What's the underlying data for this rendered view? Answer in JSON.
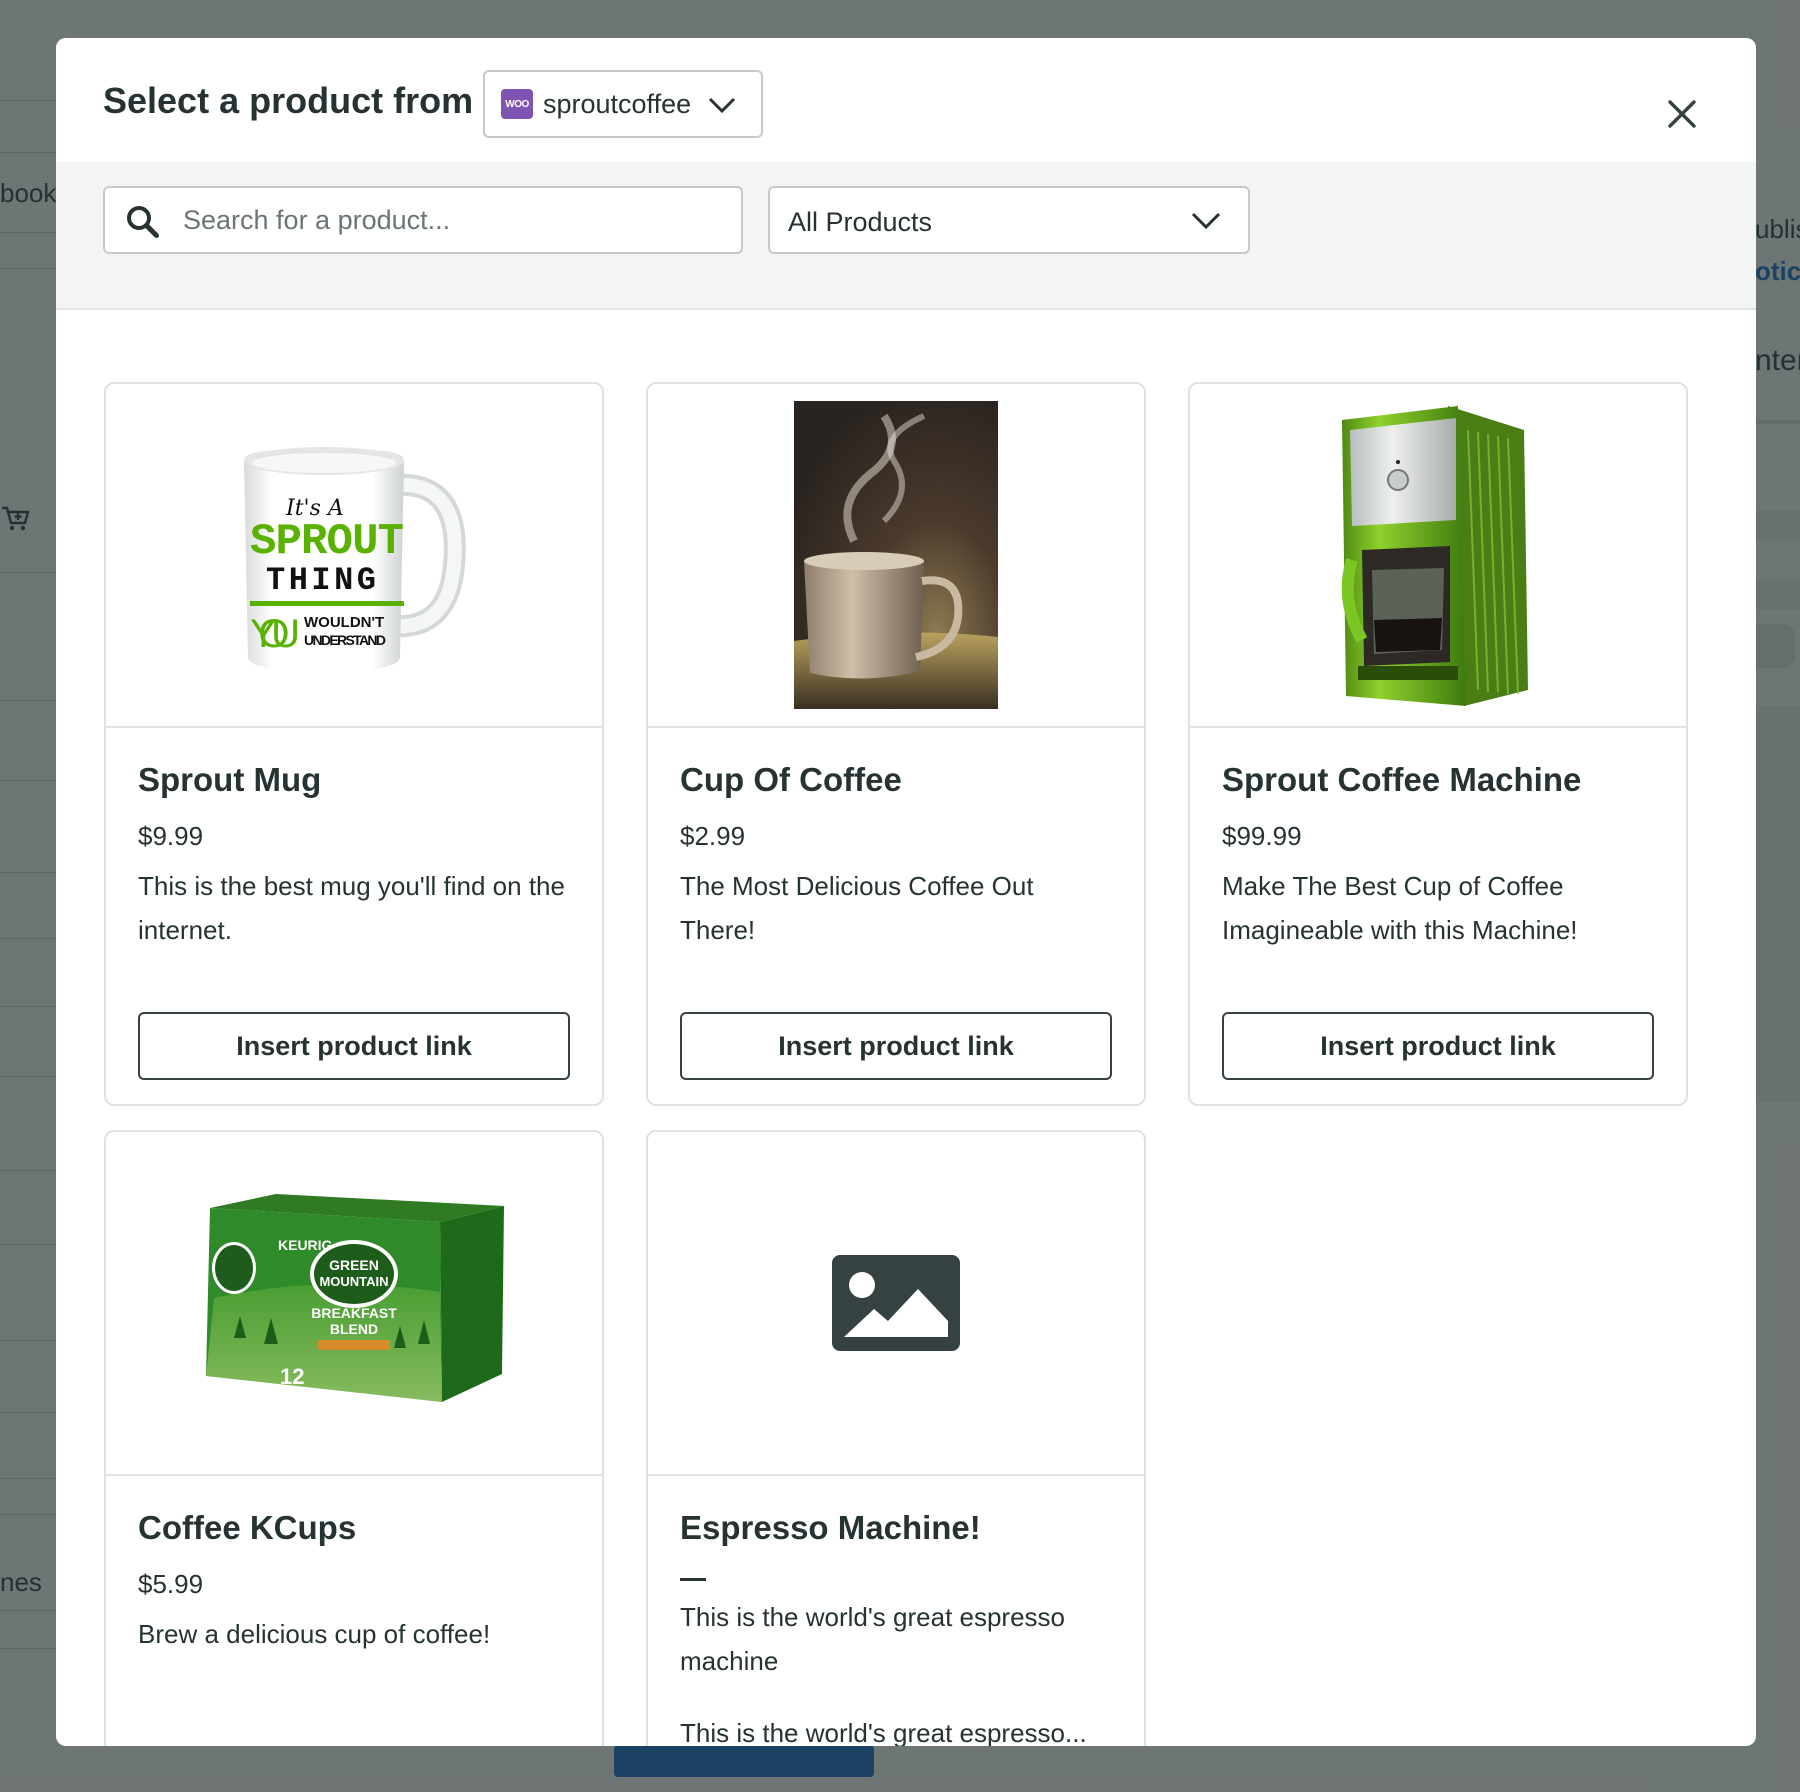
{
  "background": {
    "left_labels": [
      "book",
      "nes"
    ],
    "right_labels": [
      "ublis",
      "otice",
      "nter"
    ]
  },
  "modal": {
    "title": "Select a product from",
    "store": {
      "badge": "WOO",
      "name": "sproutcoffee"
    },
    "search": {
      "placeholder": "Search for a product...",
      "value": ""
    },
    "filter": {
      "selected": "All Products"
    },
    "colors": {
      "woo_purple": "#7f54b3",
      "brand_green": "#59b200",
      "text": "#273333"
    }
  },
  "products": [
    {
      "name": "Sprout Mug",
      "price": "$9.99",
      "description": "This is the best mug you'll find on the internet.",
      "button": "Insert product link",
      "image": "mug",
      "mug_text": {
        "line1": "It's A",
        "line2": "SPROUT",
        "line3": "THING",
        "line4": "YOU",
        "line5": "WOULDN'T",
        "line6": "UNDERSTAND"
      }
    },
    {
      "name": "Cup Of Coffee",
      "price": "$2.99",
      "description": "The Most Delicious Coffee Out There!",
      "button": "Insert product link",
      "image": "coffee-cup-photo"
    },
    {
      "name": "Sprout Coffee Machine",
      "price": "$99.99",
      "description": "Make The Best Cup of Coffee Imagineable with this Machine!",
      "button": "Insert product link",
      "image": "coffee-machine"
    },
    {
      "name": "Coffee KCups",
      "price": "$5.99",
      "description": "Brew a delicious cup of coffee!",
      "image": "kcup-box",
      "box_text": {
        "brand": "KEURIG",
        "name1": "GREEN",
        "name2": "MOUNTAIN",
        "blend1": "BREAKFAST",
        "blend2": "BLEND",
        "count": "12"
      }
    },
    {
      "name": "Espresso Machine!",
      "price": "—",
      "description": "This is the world's great espresso machine",
      "description_truncated": "This is the world's great espresso...",
      "image": "image-placeholder-icon"
    }
  ]
}
